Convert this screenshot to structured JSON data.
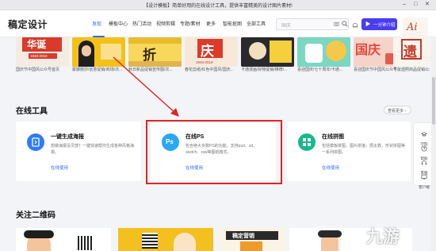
{
  "window": {
    "title": "【设计模板】简单好用的在线设计工具，提供丰富精美的设计图片素材!",
    "controls": [
      "–",
      "□",
      "✕"
    ]
  },
  "header": {
    "logo": "稿定设计",
    "nav": [
      "发现",
      "模板中心",
      "热门活动",
      "视频剪辑",
      "专题/素材",
      "更多",
      "智能抠图",
      "全部工具"
    ],
    "search_placeholder": "国庆",
    "upgrade_label": "一分钟介绍",
    "avatar_text": "Ai"
  },
  "thumbs": {
    "items": [
      {
        "caption": "国庆节中国风公众号首页",
        "banner": "华诞",
        "year": "1949-2019"
      },
      {
        "caption": "蒙娜丽莎/创意促销/商场/次...",
        "banner": "",
        "year": ""
      },
      {
        "caption": "秋日新品促销宣传图/次...",
        "banner": "折",
        "year": ""
      },
      {
        "caption": "春花剪纸/红色中国风/国庆...",
        "banner": "庆",
        "year": "1949-2019"
      },
      {
        "caption": "卡通漫画/好物促销/推荐/...",
        "banner": "",
        "year": ""
      },
      {
        "caption": "喜迎国庆/七十周年/卡通...",
        "banner": "",
        "year": ""
      },
      {
        "caption": "喜迎国庆节中国风公众号...",
        "banner": "国庆",
        "year": ""
      },
      {
        "caption": "千张遗照商品促销公众号首...",
        "banner": "遗",
        "year": ""
      }
    ]
  },
  "online_tools": {
    "title": "在线工具",
    "more_label": "查看更多 ›",
    "cards": [
      {
        "name": "一键生成海报",
        "desc": "想做海报没灵感？一键快速帮你生成各种风格海报。",
        "action": "在线使用",
        "icon": "poster-icon",
        "color": "#2f7bff"
      },
      {
        "name": "在线PS",
        "desc": "包含绝大多数PS的功能，支持psd、xd、sketch、raw等图纸格式。",
        "action": "在线使用",
        "icon": "ps-text",
        "badge": "Ps",
        "color": "#2aa8f2"
      },
      {
        "name": "在线拼图",
        "desc": "包括模板拼图，图片拼接，攒太数，形状拼图等一系列拼图。",
        "action": "在线使用",
        "icon": "grid-icon",
        "color": "#17b889"
      }
    ]
  },
  "sidebar": {
    "items": [
      {
        "label": "学院",
        "icon": "school-icon"
      },
      {
        "label": "帮助",
        "icon": "help-icon"
      },
      {
        "label": "客服",
        "icon": "headset-icon"
      },
      {
        "label": "客户端",
        "icon": "desktop-icon"
      }
    ]
  },
  "qr_section": {
    "title": "关注二维码",
    "items": [
      {
        "label": ""
      },
      {
        "label": ""
      },
      {
        "label": "稿定营销"
      },
      {
        "label": ""
      }
    ]
  },
  "watermark": "九游",
  "colors": {
    "accent": "#2f6bff",
    "highlight": "#e02424",
    "upgrade": "#4a3cf2"
  }
}
